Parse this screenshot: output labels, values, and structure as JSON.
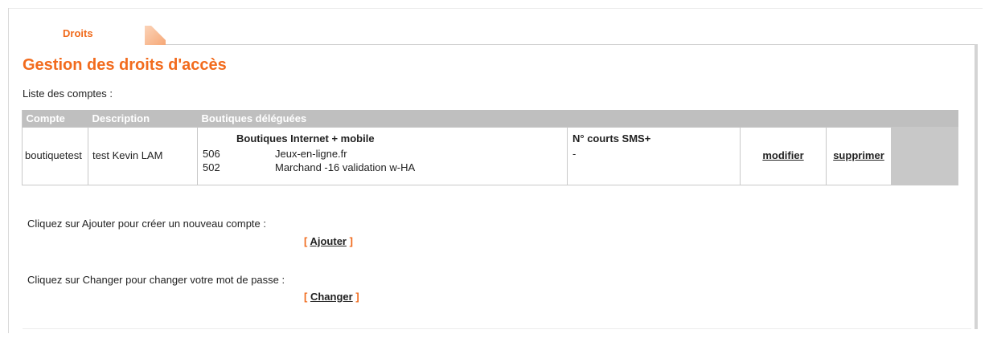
{
  "tab": {
    "label": "Droits"
  },
  "page": {
    "title": "Gestion des droits d'accès",
    "list_label": "Liste des comptes :"
  },
  "table": {
    "headers": [
      "Compte",
      "Description",
      "Boutiques déléguées"
    ],
    "shops_header": "Boutiques Internet + mobile",
    "sms_header": "N° courts SMS+",
    "rows": [
      {
        "compte": "boutiquetest",
        "description": "test Kevin LAM",
        "shops": [
          {
            "id": "506",
            "name": "Jeux-en-ligne.fr"
          },
          {
            "id": "502",
            "name": "Marchand -16 validation w-HA"
          }
        ],
        "sms": "-",
        "edit_label": "modifier",
        "delete_label": "supprimer"
      }
    ]
  },
  "add_section": {
    "help": "Cliquez sur Ajouter pour créer un nouveau compte :",
    "open_bracket": "[",
    "label": "Ajouter",
    "close_bracket": "]"
  },
  "password_section": {
    "help": "Cliquez sur Changer pour changer votre mot de passe :",
    "open_bracket": "[",
    "label": "Changer",
    "close_bracket": "]"
  },
  "colors": {
    "accent": "#f26b1d",
    "header_bg": "#bfbfbf",
    "table_border": "#c8c8c8"
  }
}
